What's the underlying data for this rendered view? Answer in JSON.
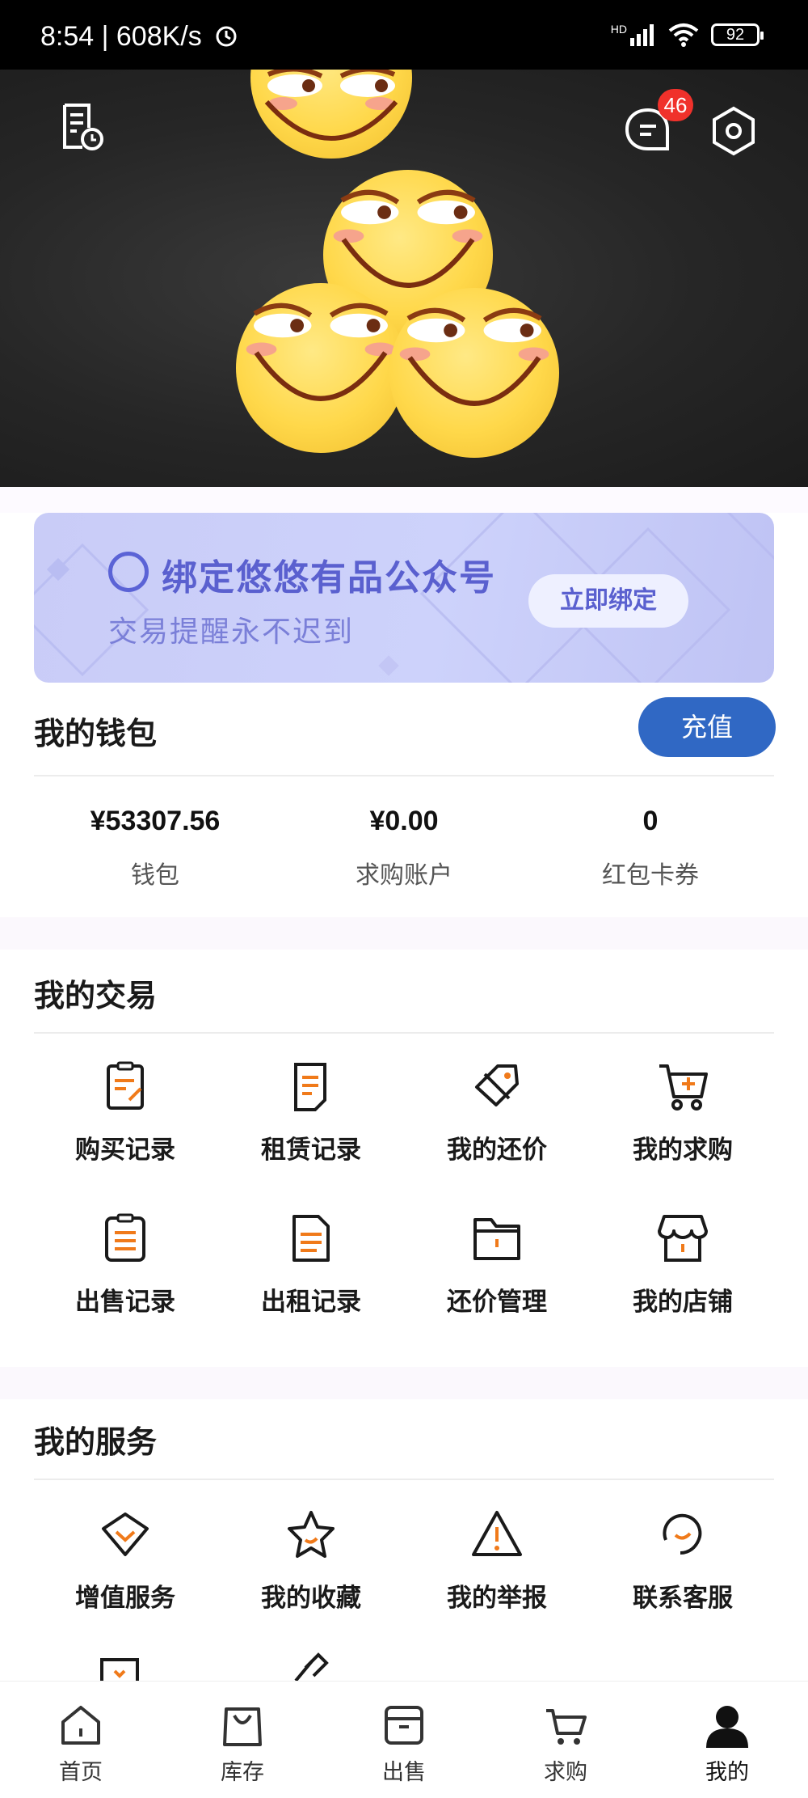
{
  "status_bar": {
    "time_speed": "8:54 | 608K/s",
    "network": "HD",
    "battery": "92"
  },
  "header": {
    "notification_count": "46"
  },
  "banner": {
    "title": "绑定悠悠有品公众号",
    "subtitle": "交易提醒永不迟到",
    "button": "立即绑定"
  },
  "wallet": {
    "title": "我的钱包",
    "recharge": "充值",
    "items": [
      {
        "value": "¥53307.56",
        "label": "钱包"
      },
      {
        "value": "¥0.00",
        "label": "求购账户"
      },
      {
        "value": "0",
        "label": "红包卡券"
      }
    ]
  },
  "trade": {
    "title": "我的交易",
    "items": [
      {
        "label": "购买记录",
        "icon": "purchase-record-icon"
      },
      {
        "label": "租赁记录",
        "icon": "rental-record-icon"
      },
      {
        "label": "我的还价",
        "icon": "price-tag-icon"
      },
      {
        "label": "我的求购",
        "icon": "cart-add-icon"
      },
      {
        "label": "出售记录",
        "icon": "sale-record-icon"
      },
      {
        "label": "出租记录",
        "icon": "lease-record-icon"
      },
      {
        "label": "还价管理",
        "icon": "folder-icon"
      },
      {
        "label": "我的店铺",
        "icon": "store-icon"
      }
    ]
  },
  "services": {
    "title": "我的服务",
    "items": [
      {
        "label": "增值服务",
        "icon": "diamond-icon"
      },
      {
        "label": "我的收藏",
        "icon": "star-icon"
      },
      {
        "label": "我的举报",
        "icon": "warning-icon"
      },
      {
        "label": "联系客服",
        "icon": "headset-icon"
      }
    ]
  },
  "nav": {
    "items": [
      {
        "label": "首页",
        "icon": "home-icon"
      },
      {
        "label": "库存",
        "icon": "bag-icon"
      },
      {
        "label": "出售",
        "icon": "box-icon"
      },
      {
        "label": "求购",
        "icon": "cart-icon"
      },
      {
        "label": "我的",
        "icon": "user-icon"
      }
    ]
  },
  "colors": {
    "accent": "#3068c4",
    "icon_orange": "#f07a1a",
    "badge": "#f0312b",
    "banner_text": "#5a60cf"
  }
}
